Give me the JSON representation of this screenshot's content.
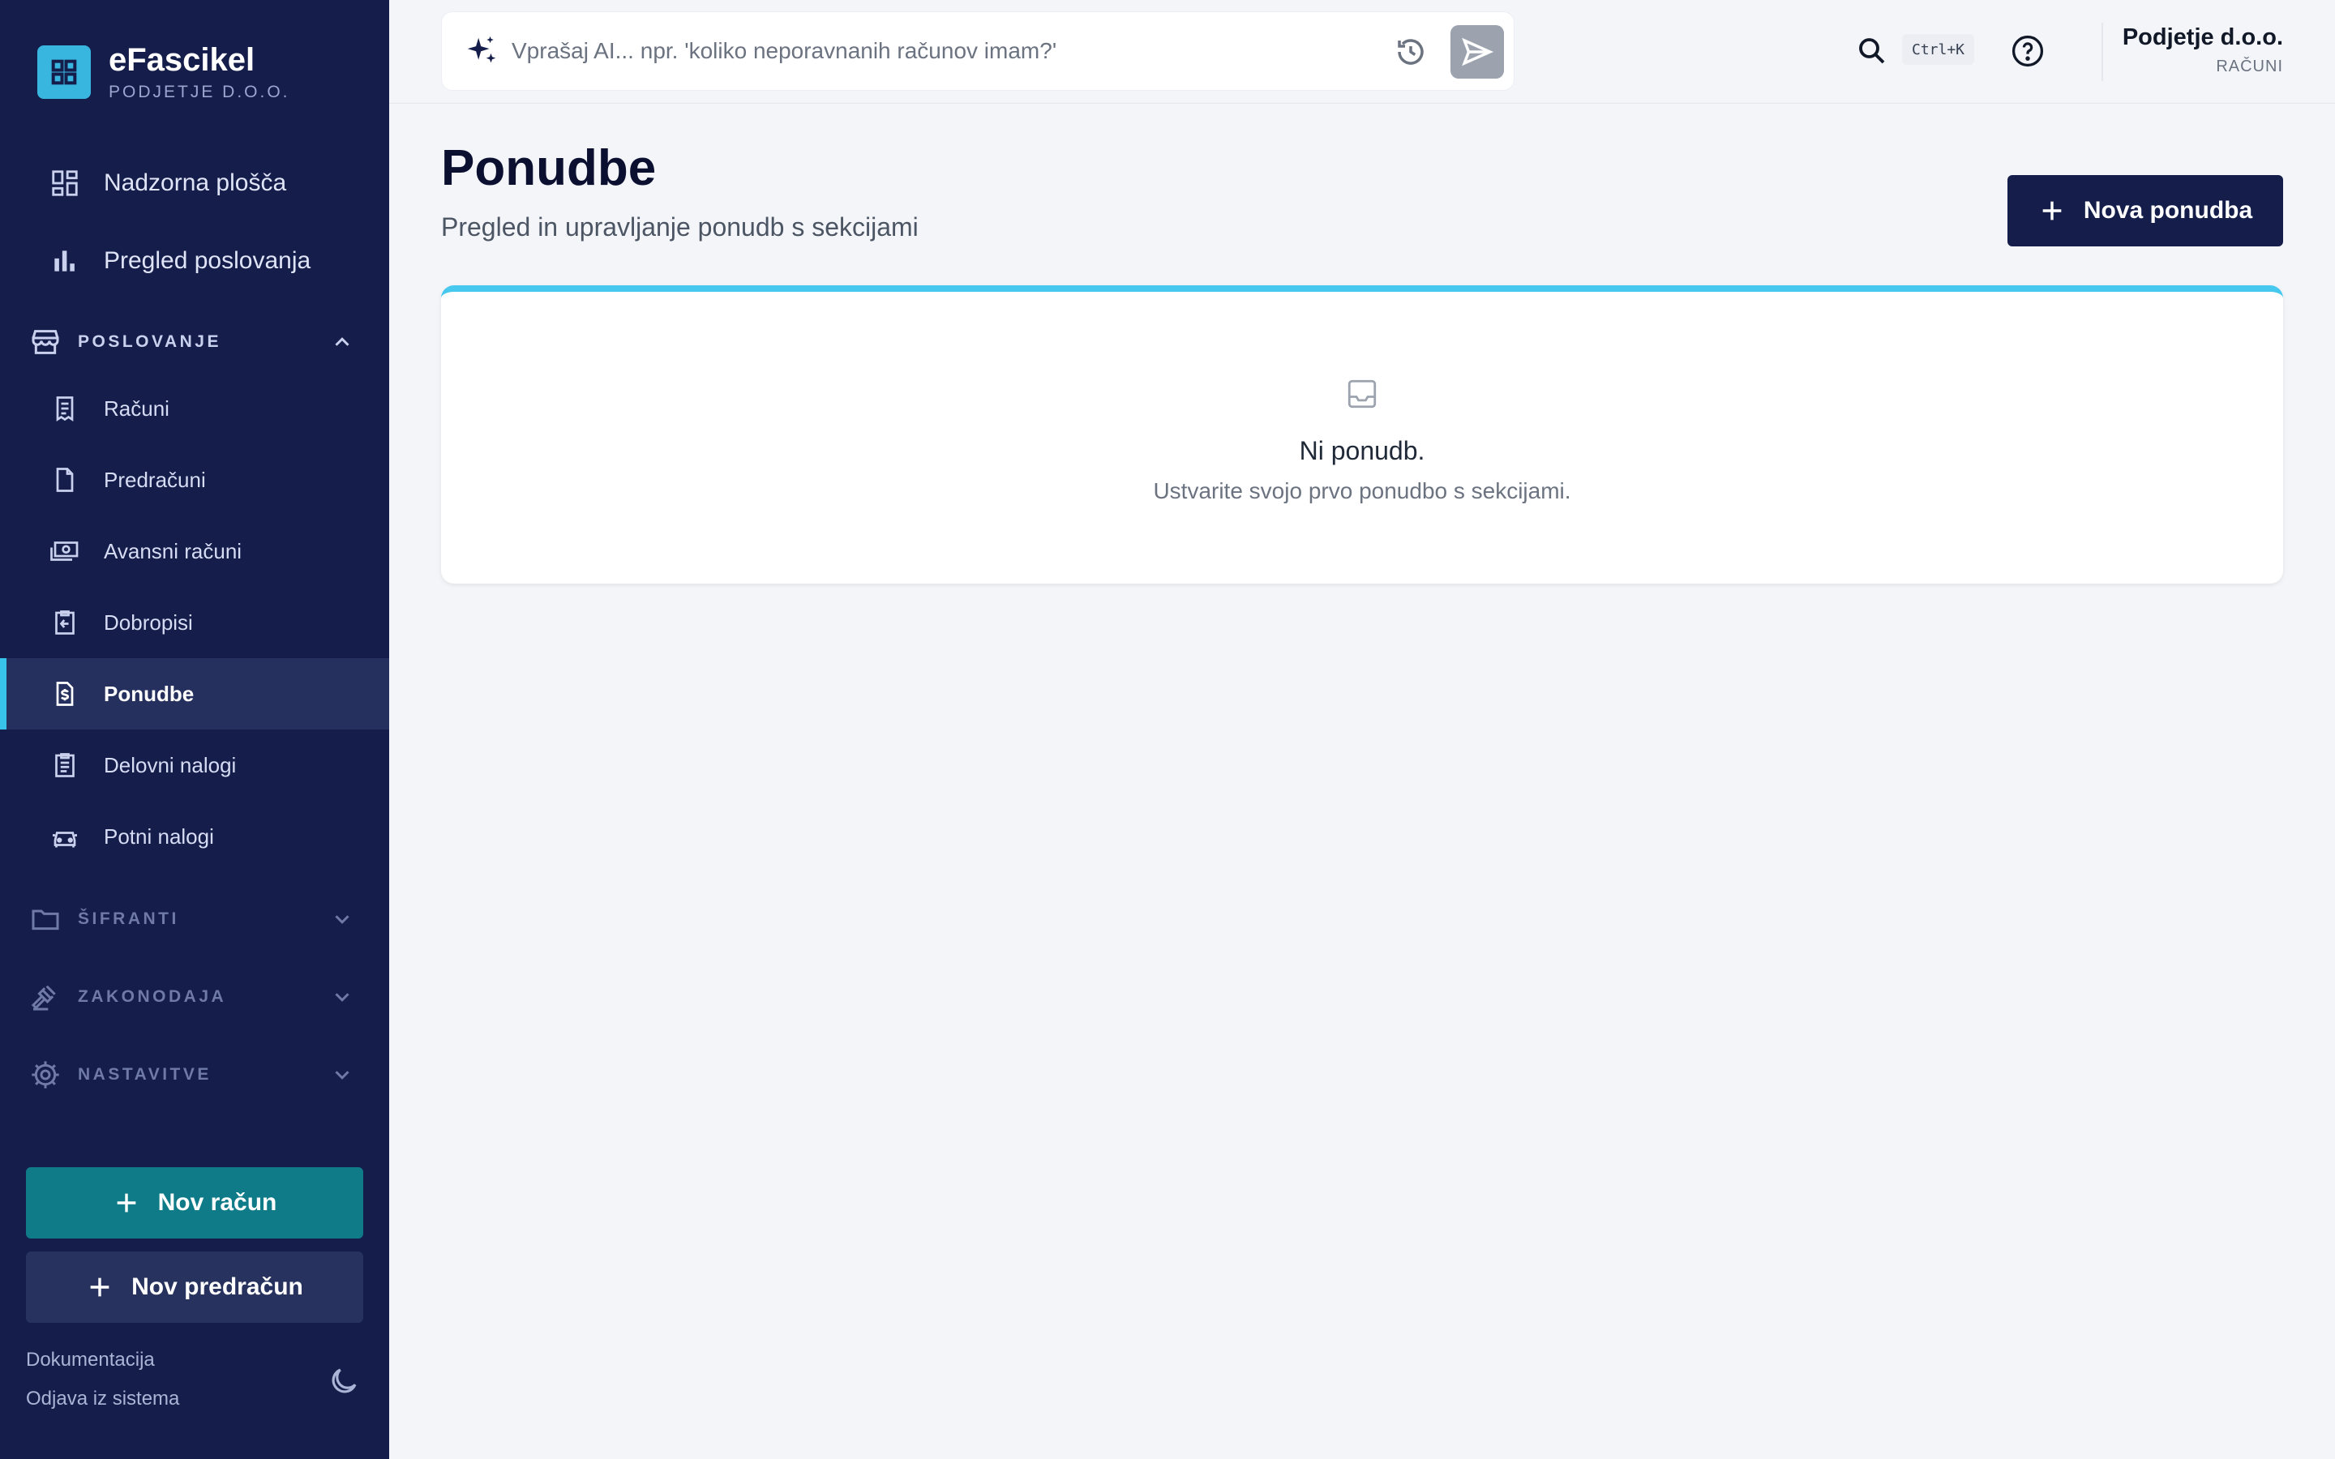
{
  "app": {
    "name": "eFascikel",
    "company_sub": "PODJETJE D.O.O."
  },
  "sidebar": {
    "top_items": [
      {
        "label": "Nadzorna plošča",
        "icon": "dashboard-icon"
      },
      {
        "label": "Pregled poslovanja",
        "icon": "bar-chart-icon"
      }
    ],
    "sections": [
      {
        "label": "POSLOVANJE",
        "icon": "store-icon",
        "expanded": true
      },
      {
        "label": "ŠIFRANTI",
        "icon": "folder-icon",
        "expanded": false
      },
      {
        "label": "ZAKONODAJA",
        "icon": "gavel-icon",
        "expanded": false
      },
      {
        "label": "NASTAVITVE",
        "icon": "gear-icon",
        "expanded": false
      }
    ],
    "items": [
      {
        "label": "Računi",
        "icon": "receipt-icon"
      },
      {
        "label": "Predračuni",
        "icon": "document-icon"
      },
      {
        "label": "Avansni računi",
        "icon": "cash-icon"
      },
      {
        "label": "Dobropisi",
        "icon": "credit-note-icon"
      },
      {
        "label": "Ponudbe",
        "icon": "quote-icon",
        "active": true
      },
      {
        "label": "Delovni nalogi",
        "icon": "clipboard-icon"
      },
      {
        "label": "Potni nalogi",
        "icon": "car-icon"
      }
    ],
    "buttons": {
      "new_invoice": "Nov račun",
      "new_proforma": "Nov predračun"
    },
    "footer": {
      "docs": "Dokumentacija",
      "logout": "Odjava iz sistema"
    }
  },
  "topbar": {
    "ai_placeholder": "Vprašaj AI... npr. 'koliko neporavnanih računov imam?'",
    "shortcut": "Ctrl+K",
    "company_name": "Podjetje d.o.o.",
    "company_section": "RAČUNI"
  },
  "main": {
    "title": "Ponudbe",
    "subtitle": "Pregled in upravljanje ponudb s sekcijami",
    "new_button": "Nova ponudba",
    "empty_title": "Ni ponudb.",
    "empty_subtitle": "Ustvarite svojo prvo ponudbo s sekcijami."
  },
  "colors": {
    "sidebar_bg": "#151d4a",
    "accent_cyan": "#38c4ea",
    "teal_button": "#0f7b88",
    "primary_navy": "#151d4a",
    "page_bg": "#f4f5f9"
  }
}
